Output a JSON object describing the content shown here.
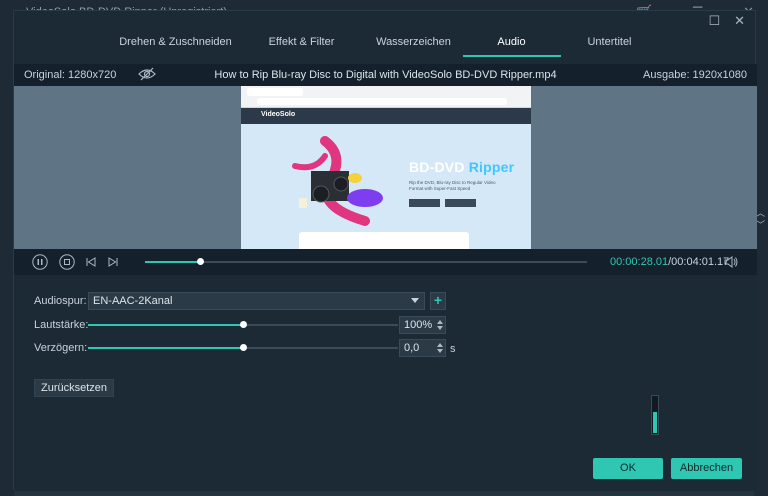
{
  "background_app": {
    "title": "VideoSolo BD-DVD Ripper (Unregistriert)",
    "icons": [
      "cart-icon",
      "search-icon",
      "menu-icon",
      "minimize-icon",
      "close-icon"
    ]
  },
  "dialog": {
    "tabs": [
      {
        "label": "Drehen & Zuschneiden",
        "active": false
      },
      {
        "label": "Effekt & Filter",
        "active": false
      },
      {
        "label": "Wasserzeichen",
        "active": false
      },
      {
        "label": "Audio",
        "active": true
      },
      {
        "label": "Untertitel",
        "active": false
      }
    ],
    "info": {
      "original": "Original: 1280x720",
      "filename": "How to Rip Blu-ray Disc to Digital with VideoSolo BD-DVD Ripper.mp4",
      "output": "Ausgabe: 1920x1080"
    },
    "video_frame": {
      "logo": "VideoSolo",
      "title_main": "BD-DVD",
      "title_accent": "Ripper",
      "subtitle": "Rip the DVD, Blu-ray Disc to Regular Video Format with Super-Fast Speed"
    },
    "playback": {
      "current_time": "00:00:28.01",
      "total_time": "/00:04:01.17",
      "progress": 0.124
    },
    "audio": {
      "track_label": "Audiospur:",
      "track_value": "EN-AAC-2Kanal",
      "volume_label": "Lautstärke:",
      "volume_value": "100%",
      "volume_level": 0.5,
      "delay_label": "Verzögern:",
      "delay_value": "0,0",
      "delay_level": 0.5,
      "delay_unit": "s",
      "reset_label": "Zurücksetzen",
      "meter_level": 0.55
    },
    "buttons": {
      "ok": "OK",
      "cancel": "Abbrechen"
    },
    "accent_color": "#2fc6b2"
  }
}
